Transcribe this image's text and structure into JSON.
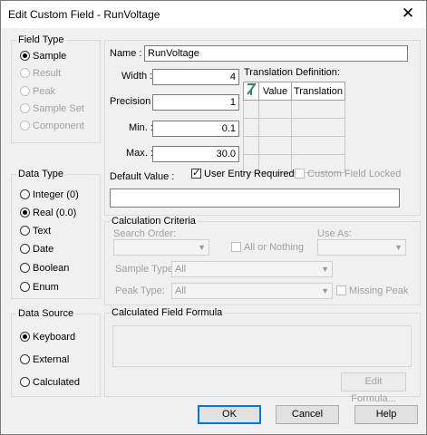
{
  "window": {
    "title": "Edit Custom Field - RunVoltage",
    "close_glyph": "✕"
  },
  "field_type": {
    "label": "Field Type",
    "options": [
      "Sample",
      "Result",
      "Peak",
      "Sample Set",
      "Component"
    ],
    "selected": "Sample"
  },
  "data_type": {
    "label": "Data Type",
    "options": [
      "Integer (0)",
      "Real (0.0)",
      "Text",
      "Date",
      "Boolean",
      "Enum"
    ],
    "selected": "Real (0.0)"
  },
  "data_source": {
    "label": "Data Source",
    "options": [
      "Keyboard",
      "External",
      "Calculated"
    ],
    "selected": "Keyboard"
  },
  "fields": {
    "name_label": "Name :",
    "name_value": "RunVoltage",
    "width_label": "Width :",
    "width_value": "4",
    "precision_label": "Precision :",
    "precision_value": "1",
    "min_label": "Min. :",
    "min_value": "0.1",
    "max_label": "Max. :",
    "max_value": "30.0",
    "default_label": "Default Value :",
    "default_value": ""
  },
  "translation": {
    "label": "Translation Definition:",
    "col_value": "Value",
    "col_translation": "Translation"
  },
  "checks": {
    "user_entry": "User Entry Required",
    "user_entry_checked": true,
    "locked": "Custom Field Locked",
    "locked_checked": false
  },
  "calc": {
    "label": "Calculation Criteria",
    "search_order": "Search Order:",
    "use_as": "Use As:",
    "all_or_nothing": "All or Nothing",
    "sample_type_label": "Sample Type:",
    "sample_type_value": "All",
    "peak_type_label": "Peak Type:",
    "peak_type_value": "All",
    "missing_peak": "Missing Peak"
  },
  "formula": {
    "label": "Calculated Field Formula",
    "edit_button": "Edit Formula..."
  },
  "buttons": {
    "ok": "OK",
    "cancel": "Cancel",
    "help": "Help"
  }
}
